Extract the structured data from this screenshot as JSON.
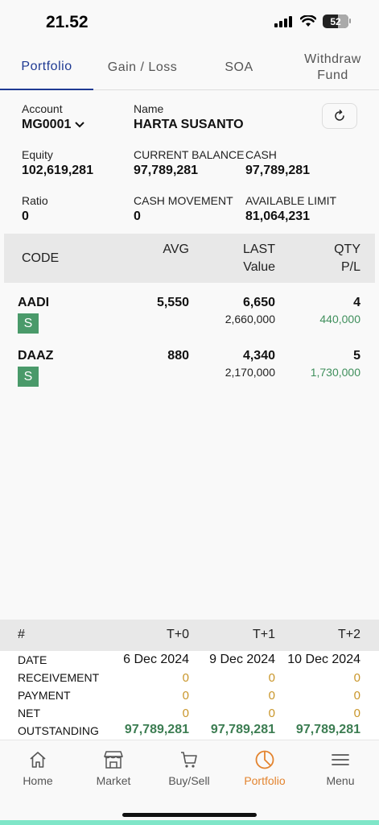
{
  "status_bar": {
    "time": "21.52",
    "battery": "52"
  },
  "tabs": [
    {
      "label": "Portfolio",
      "active": true
    },
    {
      "label": "Gain / Loss",
      "active": false
    },
    {
      "label": "SOA",
      "active": false
    },
    {
      "label": "Withdraw Fund",
      "active": false
    }
  ],
  "account": {
    "account_label": "Account",
    "account_value": "MG0001",
    "name_label": "Name",
    "name_value": "HARTA SUSANTO",
    "equity_label": "Equity",
    "equity_value": "102,619,281",
    "current_balance_label": "CURRENT BALANCE",
    "current_balance_value": "97,789,281",
    "cash_label": "CASH",
    "cash_value": "97,789,281",
    "ratio_label": "Ratio",
    "ratio_value": "0",
    "cash_movement_label": "CASH MOVEMENT",
    "cash_movement_value": "0",
    "available_limit_label": "AVAILABLE LIMIT",
    "available_limit_value": "81,064,231"
  },
  "holdings_table": {
    "headers": {
      "code": "CODE",
      "avg": "AVG",
      "last": "LAST",
      "value": "Value",
      "qty": "QTY",
      "pl": "P/L"
    },
    "rows": [
      {
        "code": "AADI",
        "badge": "S",
        "avg": "5,550",
        "last": "6,650",
        "value": "2,660,000",
        "qty": "4",
        "pl": "440,000"
      },
      {
        "code": "DAAZ",
        "badge": "S",
        "avg": "880",
        "last": "4,340",
        "value": "2,170,000",
        "qty": "5",
        "pl": "1,730,000"
      }
    ]
  },
  "settlement": {
    "headers": {
      "hash": "#",
      "t0": "T+0",
      "t1": "T+1",
      "t2": "T+2"
    },
    "rows": {
      "date": {
        "label": "DATE",
        "t0": "6 Dec 2024",
        "t1": "9 Dec 2024",
        "t2": "10 Dec 2024"
      },
      "receivement": {
        "label": "RECEIVEMENT",
        "t0": "0",
        "t1": "0",
        "t2": "0"
      },
      "payment": {
        "label": "PAYMENT",
        "t0": "0",
        "t1": "0",
        "t2": "0"
      },
      "net": {
        "label": "NET",
        "t0": "0",
        "t1": "0",
        "t2": "0"
      },
      "outstanding": {
        "label": "OUTSTANDING",
        "t0": "97,789,281",
        "t1": "97,789,281",
        "t2": "97,789,281"
      }
    }
  },
  "bottom_nav": [
    {
      "label": "Home",
      "icon": "home-icon",
      "active": false
    },
    {
      "label": "Market",
      "icon": "market-icon",
      "active": false
    },
    {
      "label": "Buy/Sell",
      "icon": "cart-icon",
      "active": false
    },
    {
      "label": "Portfolio",
      "icon": "pie-chart-icon",
      "active": true
    },
    {
      "label": "Menu",
      "icon": "menu-icon",
      "active": false
    }
  ],
  "colors": {
    "accent_blue": "#1f3a93",
    "active_orange": "#e3842f",
    "profit_green": "#3f8f5c",
    "badge_green": "#4a9a6a",
    "zero_orange": "#c9962a"
  }
}
